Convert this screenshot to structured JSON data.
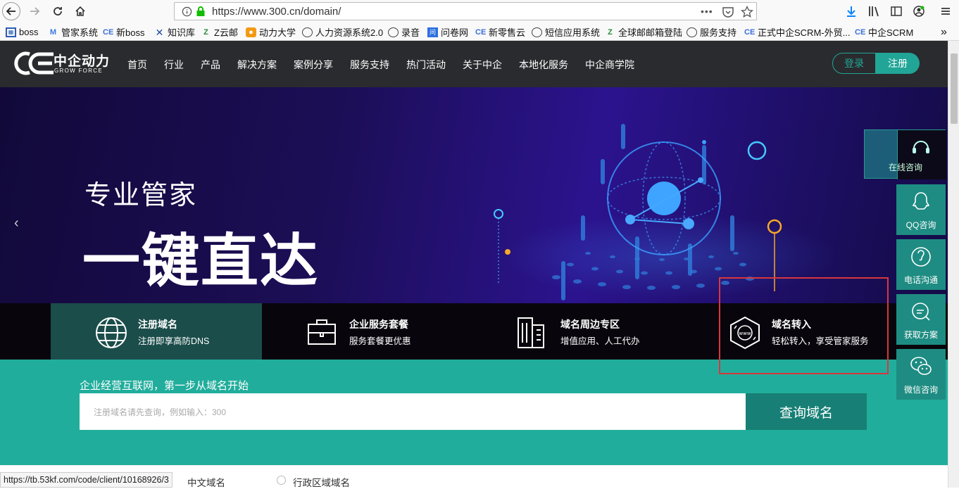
{
  "browser": {
    "url": "https://www.300.cn/domain/",
    "more_label": "•••"
  },
  "bookmarks": [
    {
      "label": "boss",
      "icon": "grid-icon"
    },
    {
      "label": "管家系统",
      "icon": "m-icon"
    },
    {
      "label": "新boss",
      "icon": "ce-icon"
    },
    {
      "label": "知识库",
      "icon": "x-icon"
    },
    {
      "label": "Z云邮",
      "icon": "z-icon"
    },
    {
      "label": "动力大学",
      "icon": "orange-icon"
    },
    {
      "label": "人力资源系统2.0",
      "icon": "globe-icon"
    },
    {
      "label": "录音",
      "icon": "globe-icon"
    },
    {
      "label": "问卷网",
      "icon": "wj-icon"
    },
    {
      "label": "新零售云",
      "icon": "ce-icon"
    },
    {
      "label": "短信应用系统",
      "icon": "globe-icon"
    },
    {
      "label": "全球邮邮箱登陆",
      "icon": "z-icon"
    },
    {
      "label": "服务支持",
      "icon": "globe-icon"
    },
    {
      "label": "正式中企SCRM-外贸...",
      "icon": "ce-icon"
    },
    {
      "label": "中企SCRM",
      "icon": "ce-icon"
    }
  ],
  "site": {
    "logo_cn": "中企动力",
    "logo_en": "GROW FORCE",
    "nav": [
      "首页",
      "行业",
      "产品",
      "解决方案",
      "案例分享",
      "服务支持",
      "热门活动",
      "关于中企",
      "本地化服务",
      "中企商学院"
    ],
    "login_label": "登录",
    "register_label": "注册"
  },
  "hero": {
    "subtitle": "专业管家",
    "title": "一键直达",
    "prev_arrow": "‹"
  },
  "features": [
    {
      "title": "注册域名",
      "desc": "注册即享高防DNS",
      "icon": "globe-icon"
    },
    {
      "title": "企业服务套餐",
      "desc": "服务套餐更优惠",
      "icon": "briefcase-icon"
    },
    {
      "title": "域名周边专区",
      "desc": "增值应用、人工代办",
      "icon": "building-icon"
    },
    {
      "title": "域名转入",
      "desc": "轻松转入，享受管家服务",
      "icon": "www-transfer-icon"
    }
  ],
  "search": {
    "caption": "企业经营互联网，第一步从域名开始",
    "placeholder": "注册域名请先查询，例如输入：300",
    "button": "查询域名"
  },
  "bottom": {
    "status_url": "https://tb.53kf.com/code/client/10168926/3",
    "option1": "中文域名",
    "option2": "行政区域域名"
  },
  "float": {
    "online": "在线咨询",
    "qq": "QQ咨询",
    "phone": "电话沟通",
    "plan": "获取方案",
    "wechat": "微信咨询"
  },
  "colors": {
    "teal": "#21ad9c",
    "dark_teal": "#177f75",
    "nav_bg": "#2a2b2e",
    "highlight": "#d9363e"
  }
}
